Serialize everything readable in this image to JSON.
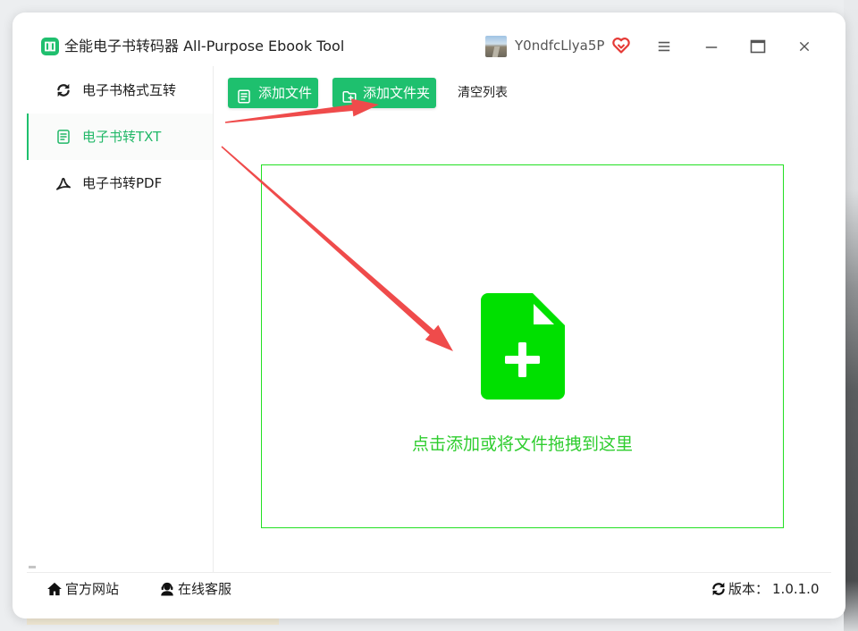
{
  "app": {
    "title": "全能电子书转码器 All-Purpose Ebook Tool",
    "logo_icon": "app-logo-icon",
    "user": {
      "name": "Y0ndfcLlya5P",
      "badge_icon": "vip-heart-icon"
    }
  },
  "colors": {
    "accent": "#1ec06e",
    "selected_text": "#22b868",
    "drop_zone": "#22e022",
    "drop_icon": "#00e000",
    "drop_text": "#2fcd2f",
    "vip": "#e53935",
    "annotation": "#ef4b4b"
  },
  "window_controls": {
    "menu": "menu-icon",
    "minimize": "minimize-icon",
    "maximize": "maximize-icon",
    "close": "close-icon"
  },
  "sidebar": {
    "items": [
      {
        "label": "电子书格式互转",
        "icon": "convert-refresh-icon",
        "selected": false
      },
      {
        "label": "电子书转TXT",
        "icon": "txt-document-icon",
        "selected": true
      },
      {
        "label": "电子书转PDF",
        "icon": "pdf-acrobat-icon",
        "selected": false
      }
    ]
  },
  "toolbar": {
    "add_file": {
      "label": "添加文件",
      "icon": "add-file-icon"
    },
    "add_folder": {
      "label": "添加文件夹",
      "icon": "add-folder-icon"
    },
    "clear_list": {
      "label": "清空列表"
    }
  },
  "drop_zone": {
    "icon": "file-plus-icon",
    "hint": "点击添加或将文件拖拽到这里"
  },
  "footer": {
    "website": {
      "label": "官方网站",
      "icon": "home-icon"
    },
    "support": {
      "label": "在线客服",
      "icon": "customer-service-icon"
    },
    "version": {
      "label": "版本：",
      "value": "1.0.1.0",
      "icon": "refresh-icon"
    }
  }
}
